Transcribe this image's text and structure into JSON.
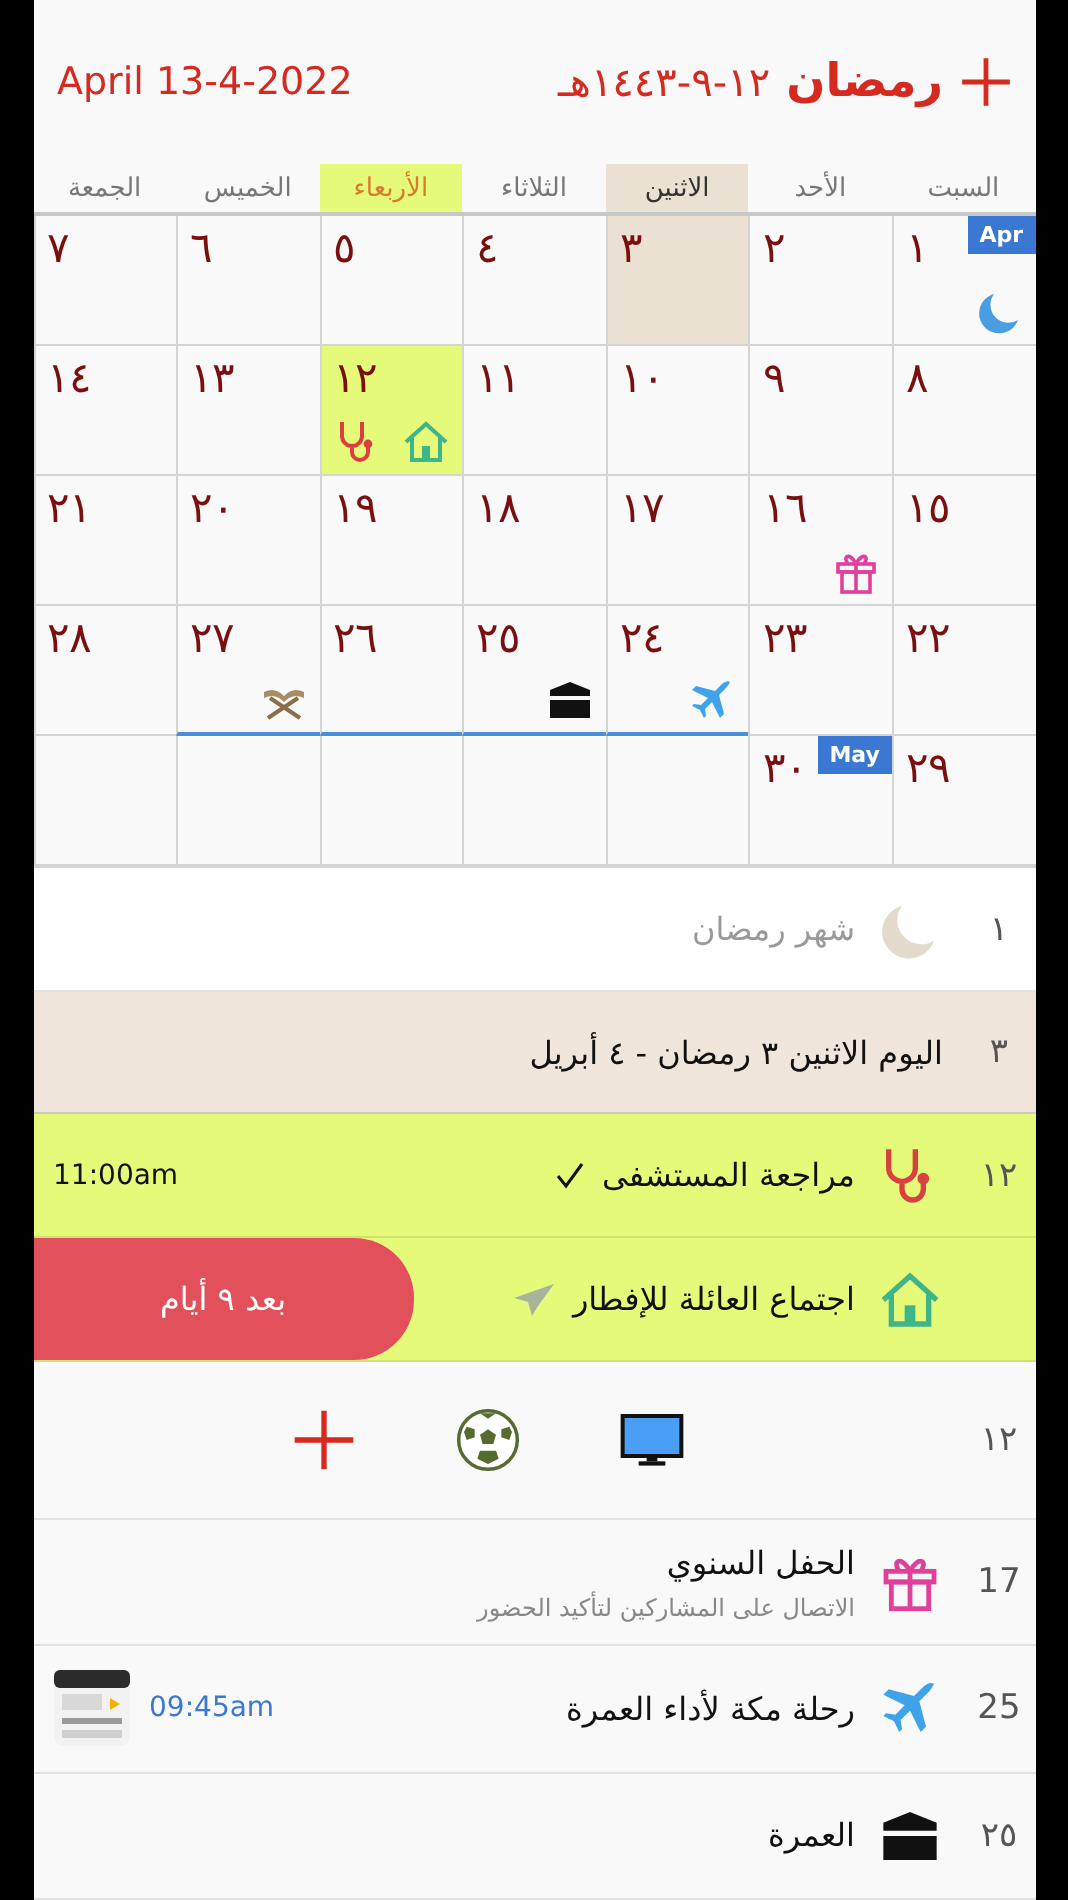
{
  "header": {
    "month": "رمضان",
    "hijri_date": "١٢-٩-١٤٤٣هـ",
    "gregorian_date": "April 13-4-2022"
  },
  "weekdays": [
    {
      "label": "السبت",
      "selected": false,
      "today": false
    },
    {
      "label": "الأحد",
      "selected": false,
      "today": false
    },
    {
      "label": "الاثنين",
      "selected": true,
      "today": false
    },
    {
      "label": "الثلاثاء",
      "selected": false,
      "today": false
    },
    {
      "label": "الأربعاء",
      "selected": false,
      "today": true
    },
    {
      "label": "الخميس",
      "selected": false,
      "today": false
    },
    {
      "label": "الجمعة",
      "selected": false,
      "today": false
    }
  ],
  "weeks": [
    [
      {
        "day": "١",
        "month_badge": "Apr",
        "icons": [
          {
            "kind": "moon"
          }
        ],
        "selected": false,
        "today": false,
        "underline": false
      },
      {
        "day": "٢",
        "selected": false,
        "today": false,
        "underline": false
      },
      {
        "day": "٣",
        "selected": true,
        "today": false,
        "underline": false
      },
      {
        "day": "٤",
        "selected": false,
        "today": false,
        "underline": false
      },
      {
        "day": "٥",
        "selected": false,
        "today": false,
        "underline": false
      },
      {
        "day": "٦",
        "selected": false,
        "today": false,
        "underline": false
      },
      {
        "day": "٧",
        "selected": false,
        "today": false,
        "underline": false
      }
    ],
    [
      {
        "day": "٨",
        "selected": false,
        "today": false,
        "underline": false
      },
      {
        "day": "٩",
        "selected": false,
        "today": false,
        "underline": false
      },
      {
        "day": "١٠",
        "selected": false,
        "today": false,
        "underline": false
      },
      {
        "day": "١١",
        "selected": false,
        "today": false,
        "underline": false
      },
      {
        "day": "١٢",
        "icons": [
          {
            "kind": "house"
          },
          {
            "kind": "stethoscope"
          }
        ],
        "selected": false,
        "today": true,
        "underline": false
      },
      {
        "day": "١٣",
        "selected": false,
        "today": false,
        "underline": false
      },
      {
        "day": "١٤",
        "selected": false,
        "today": false,
        "underline": false
      }
    ],
    [
      {
        "day": "١٥",
        "selected": false,
        "today": false,
        "underline": false
      },
      {
        "day": "١٦",
        "icons": [
          {
            "kind": "gift"
          }
        ],
        "selected": false,
        "today": false,
        "underline": false
      },
      {
        "day": "١٧",
        "selected": false,
        "today": false,
        "underline": false
      },
      {
        "day": "١٨",
        "selected": false,
        "today": false,
        "underline": false
      },
      {
        "day": "١٩",
        "selected": false,
        "today": false,
        "underline": false
      },
      {
        "day": "٢٠",
        "selected": false,
        "today": false,
        "underline": false
      },
      {
        "day": "٢١",
        "selected": false,
        "today": false,
        "underline": false
      }
    ],
    [
      {
        "day": "٢٢",
        "selected": false,
        "today": false,
        "underline": false
      },
      {
        "day": "٢٣",
        "selected": false,
        "today": false,
        "underline": false
      },
      {
        "day": "٢٤",
        "icons": [
          {
            "kind": "plane"
          }
        ],
        "selected": false,
        "today": false,
        "underline": true
      },
      {
        "day": "٢٥",
        "icons": [
          {
            "kind": "kaaba"
          }
        ],
        "selected": false,
        "today": false,
        "underline": true
      },
      {
        "day": "٢٦",
        "selected": false,
        "today": false,
        "underline": true
      },
      {
        "day": "٢٧",
        "icons": [
          {
            "kind": "book-stand"
          }
        ],
        "selected": false,
        "today": false,
        "underline": true
      },
      {
        "day": "٢٨",
        "selected": false,
        "today": false,
        "underline": false
      }
    ],
    [
      {
        "day": "٢٩",
        "selected": false,
        "today": false,
        "underline": false
      },
      {
        "day": "٣٠",
        "month_badge": "May",
        "selected": false,
        "today": false,
        "underline": false
      }
    ]
  ],
  "list": [
    {
      "kind": "note",
      "number": "١",
      "icon": {
        "kind": "moon"
      },
      "title": "شهر رمضان"
    },
    {
      "kind": "day-header",
      "number": "٣",
      "title": "اليوم الاثنين ٣ رمضان - ٤ أبريل"
    },
    {
      "kind": "today-event",
      "number": "١٢",
      "icon": {
        "kind": "stethoscope"
      },
      "title": "مراجعة المستشفى",
      "done": true,
      "time": "11:00am"
    },
    {
      "kind": "today-event",
      "icon": {
        "kind": "house"
      },
      "title": "اجتماع العائلة للإفطار",
      "sent": true,
      "countdown": "بعد ٩ أيام"
    },
    {
      "kind": "shortcuts",
      "number": "١٢",
      "icons": [
        {
          "kind": "monitor"
        },
        {
          "kind": "soccer"
        },
        {
          "kind": "plus"
        }
      ]
    },
    {
      "kind": "event",
      "number": "17",
      "icon": {
        "kind": "gift"
      },
      "title": "الحفل السنوي",
      "subtitle": "الاتصال على المشاركين لتأكيد الحضور"
    },
    {
      "kind": "event",
      "number": "25",
      "icon": {
        "kind": "plane"
      },
      "title": "رحلة مكة لأداء العمرة",
      "time": "09:45am"
    },
    {
      "kind": "event",
      "number": "٢٥",
      "icon": {
        "kind": "kaaba"
      },
      "title": "العمرة"
    }
  ]
}
